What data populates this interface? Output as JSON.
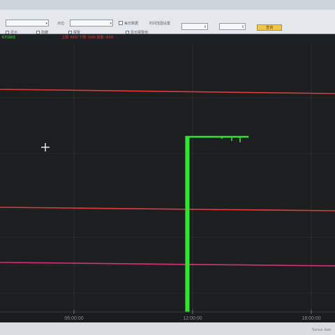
{
  "toolbar": {
    "device_select": "",
    "point_label": "点位:",
    "point_select": "",
    "check1_label": "每日数据",
    "range_label": "时间范围设置",
    "start_value": "",
    "end_value": "",
    "query_label": "查询"
  },
  "options_row": {
    "opt1": "显示",
    "opt2": "隐藏",
    "opt3": "报警",
    "opt4": "显示报警值"
  },
  "legend": {
    "left_label": "实时曲线",
    "red_text": "上限: 0000  下限: 0000  报警: 0000"
  },
  "colors": {
    "background": "#1c1e20",
    "limit_line": "#e03a3a",
    "low_line": "#d4327a",
    "signal": "#2ee62e",
    "grid": "#2c3034"
  },
  "chart_data": {
    "type": "line",
    "x_axis": {
      "tick_labels": [
        "06:00:00",
        "12:00:00",
        "18:00:00"
      ],
      "range": [
        "00:00:00",
        "19:00:00"
      ]
    },
    "horizontal_lines": [
      {
        "color": "red",
        "level": "upper"
      },
      {
        "color": "red",
        "level": "middle"
      },
      {
        "color": "pink",
        "level": "lower"
      }
    ],
    "series": [
      {
        "color": "green",
        "points": [
          {
            "x": "11:40:00",
            "y": 0
          },
          {
            "x": "11:40:00",
            "y": 1
          },
          {
            "x": "11:45:00",
            "y": 1
          },
          {
            "x": "11:45:00",
            "y": 0
          },
          {
            "x": "11:48:00",
            "y": 0
          },
          {
            "x": "11:48:00",
            "y": 1
          },
          {
            "x": "14:50:00",
            "y": 1
          }
        ]
      }
    ],
    "grid": true
  },
  "status": {
    "text": "Sensor data"
  }
}
